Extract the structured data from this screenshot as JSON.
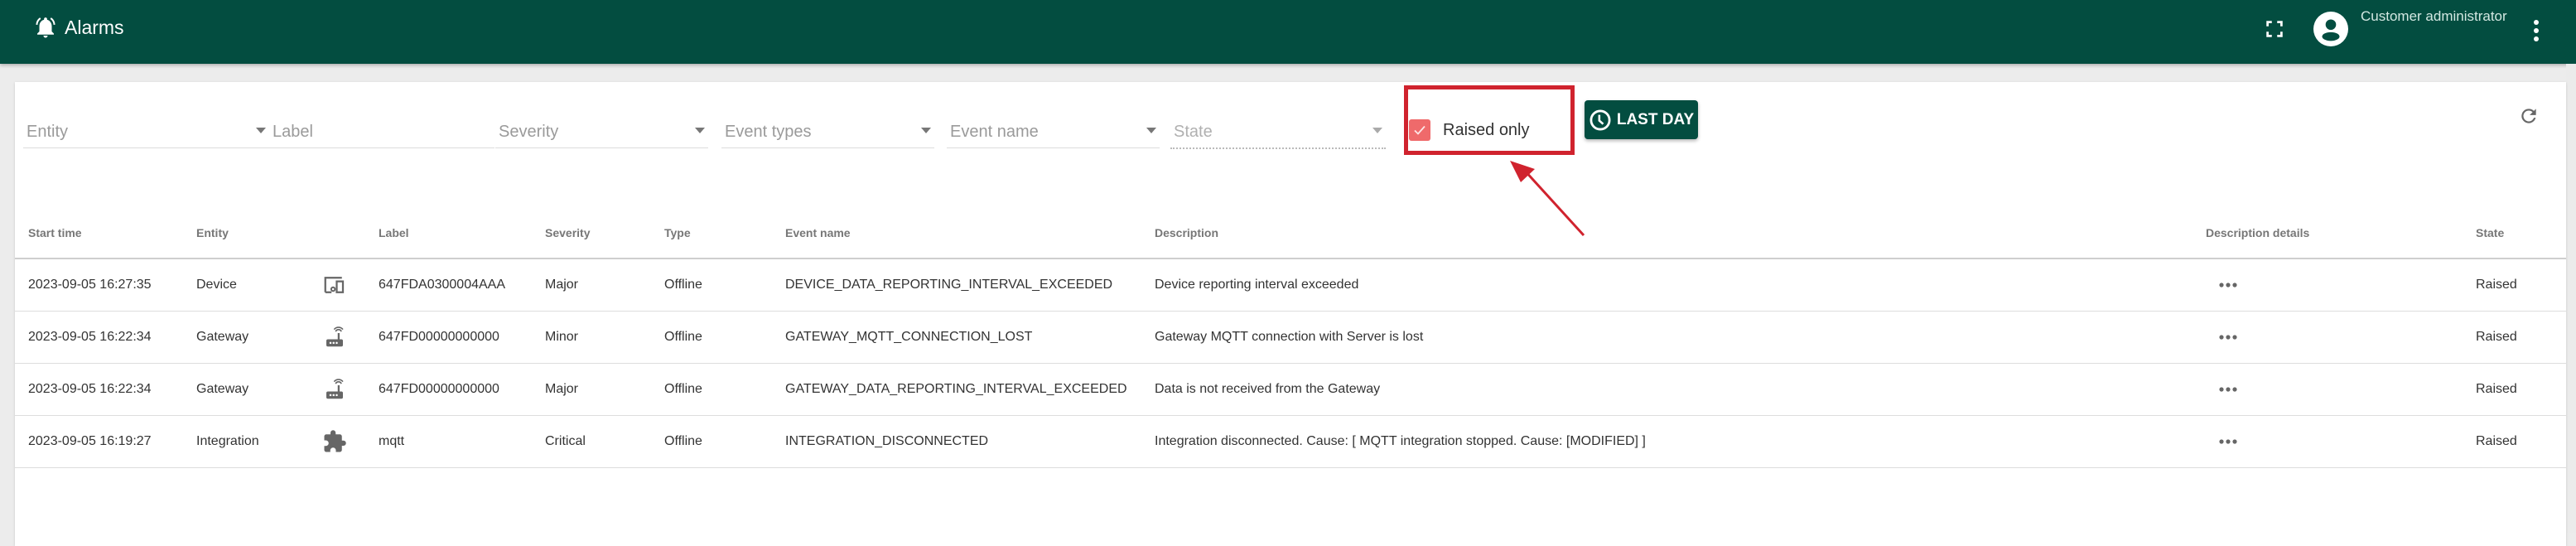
{
  "topbar": {
    "title": "Alarms",
    "title_icon": "alarm-bell-icon",
    "user_name": "Customer administrator",
    "icons": [
      "fullscreen-icon",
      "account-circle-icon",
      "more-vert-icon"
    ]
  },
  "filters": {
    "entity": {
      "placeholder": "Entity"
    },
    "label": {
      "placeholder": "Label"
    },
    "severity": {
      "placeholder": "Severity"
    },
    "event_types": {
      "placeholder": "Event types"
    },
    "event_name": {
      "placeholder": "Event name"
    },
    "state": {
      "placeholder": "State"
    },
    "raised_only": {
      "label": "Raised only",
      "checked": true
    },
    "time_button": {
      "label": "LAST DAY"
    }
  },
  "accent_colors": {
    "primary": "#034d40",
    "checkbox": "#ef6a6b",
    "annotation": "#d0232e"
  },
  "table": {
    "columns": [
      "Start time",
      "Entity",
      "",
      "Label",
      "Severity",
      "Type",
      "Event name",
      "Description",
      "Description details",
      "State"
    ],
    "rows": [
      {
        "start_time": "2023-09-05 16:27:35",
        "entity": "Device",
        "entity_icon": "device-icon",
        "label": "647FDA0300004AAA",
        "severity": "Major",
        "type": "Offline",
        "event_name": "DEVICE_DATA_REPORTING_INTERVAL_EXCEEDED",
        "description": "Device reporting interval exceeded",
        "details": "•••",
        "state": "Raised"
      },
      {
        "start_time": "2023-09-05 16:22:34",
        "entity": "Gateway",
        "entity_icon": "router-icon",
        "label": "647FD00000000000",
        "severity": "Minor",
        "type": "Offline",
        "event_name": "GATEWAY_MQTT_CONNECTION_LOST",
        "description": "Gateway MQTT connection with Server is lost",
        "details": "•••",
        "state": "Raised"
      },
      {
        "start_time": "2023-09-05 16:22:34",
        "entity": "Gateway",
        "entity_icon": "router-icon",
        "label": "647FD00000000000",
        "severity": "Major",
        "type": "Offline",
        "event_name": "GATEWAY_DATA_REPORTING_INTERVAL_EXCEEDED",
        "description": "Data is not received from the Gateway",
        "details": "•••",
        "state": "Raised"
      },
      {
        "start_time": "2023-09-05 16:19:27",
        "entity": "Integration",
        "entity_icon": "puzzle-icon",
        "label": "mqtt",
        "severity": "Critical",
        "type": "Offline",
        "event_name": "INTEGRATION_DISCONNECTED",
        "description": "Integration disconnected. Cause: [ MQTT integration stopped. Cause: [MODIFIED] ]",
        "details": "•••",
        "state": "Raised"
      }
    ]
  }
}
